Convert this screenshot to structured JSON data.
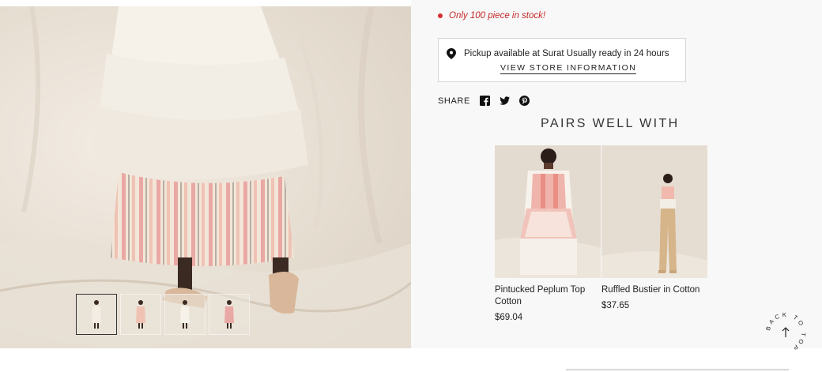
{
  "stock": {
    "text": "Only 100 piece in stock!",
    "color": "#c62828"
  },
  "pickup": {
    "text": "Pickup available at Surat Usually ready in 24 hours",
    "link_label": "VIEW STORE INFORMATION",
    "icon": "map-pin-icon"
  },
  "share": {
    "label": "SHARE",
    "icons": [
      "facebook-icon",
      "twitter-icon",
      "pinterest-icon"
    ]
  },
  "pairs": {
    "title": "PAIRS WELL WITH",
    "items": [
      {
        "name": "Pintucked Peplum Top Cotton",
        "price": "$69.04"
      },
      {
        "name": "Ruffled Bustier in Cotton",
        "price": "$37.65"
      }
    ]
  },
  "gallery": {
    "thumb_count": 4,
    "active_index": 0
  },
  "back_to_top": {
    "label": "BACK TO TOP",
    "icon": "arrow-up-icon"
  }
}
